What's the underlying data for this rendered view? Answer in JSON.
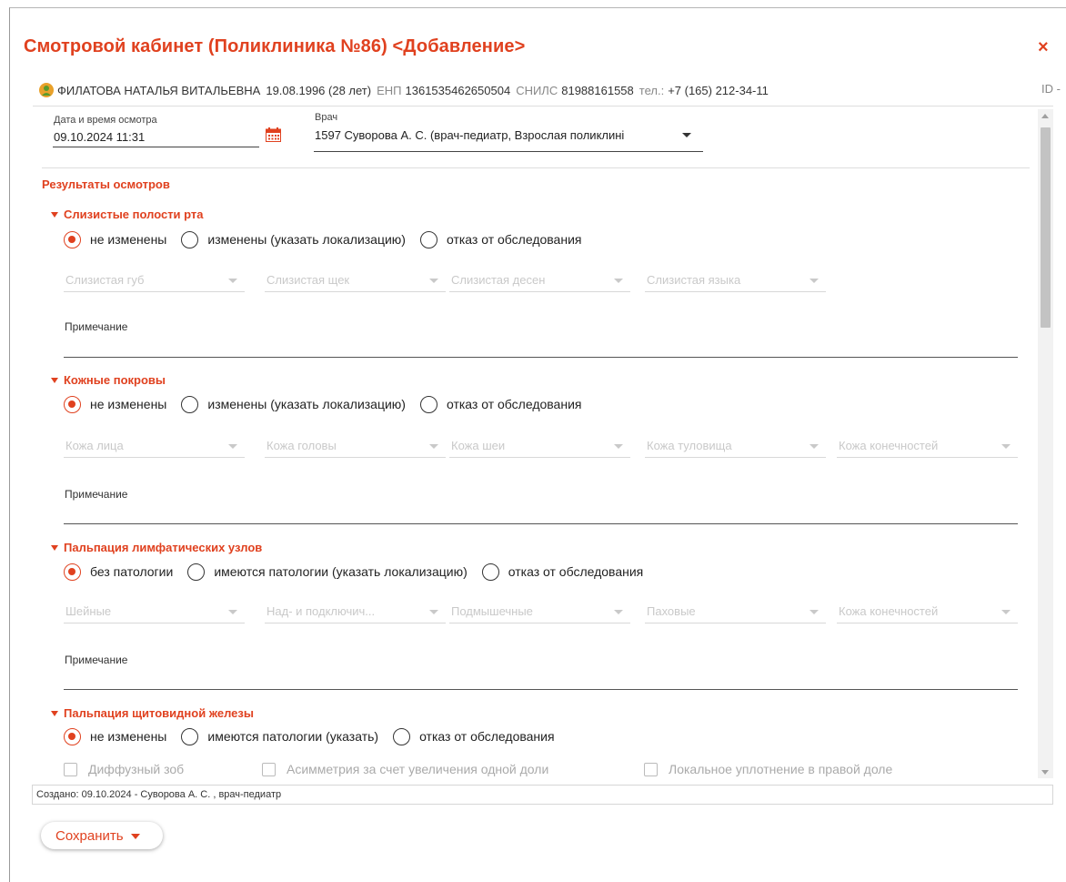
{
  "dialog": {
    "title": "Смотровой кабинет (Поликлиника №86) <Добавление>",
    "close_label": "×",
    "id_label": "ID -"
  },
  "patient": {
    "name": "ФИЛАТОВА НАТАЛЬЯ ВИТАЛЬЕВНА",
    "birth": "19.08.1996 (28 лет)",
    "enp_label": "ЕНП",
    "enp_value": "1361535462650504",
    "snils_label": "СНИЛС",
    "snils_value": "81988161558",
    "phone_label": "тел.:",
    "phone_value": "+7 (165) 212-34-11"
  },
  "exam": {
    "datetime_label": "Дата и время осмотра",
    "datetime_value": "09.10.2024 11:31",
    "doctor_label": "Врач",
    "doctor_value": "1597 Суворова А. С.  (врач-педиатр, Взрослая поликлині"
  },
  "results_title": "Результаты осмотров",
  "sections": {
    "mucosa": {
      "title": "Слизистые полости рта",
      "radios": [
        "не изменены",
        "изменены (указать локализацию)",
        "отказ от обследования"
      ],
      "selected": 0,
      "dropdowns": [
        "Слизистая губ",
        "Слизистая щек",
        "Слизистая десен",
        "Слизистая языка"
      ],
      "note_label": "Примечание"
    },
    "skin": {
      "title": "Кожные покровы",
      "radios": [
        "не изменены",
        "изменены (указать локализацию)",
        "отказ от обследования"
      ],
      "selected": 0,
      "dropdowns": [
        "Кожа лица",
        "Кожа головы",
        "Кожа шеи",
        "Кожа туловища",
        "Кожа конечностей"
      ],
      "note_label": "Примечание"
    },
    "lymph": {
      "title": "Пальпация лимфатических узлов",
      "radios": [
        "без патологии",
        "имеются патологии (указать локализацию)",
        "отказ от обследования"
      ],
      "selected": 0,
      "dropdowns": [
        "Шейные",
        "Над- и подключич...",
        "Подмышечные",
        "Паховые",
        "Кожа конечностей"
      ],
      "note_label": "Примечание"
    },
    "thyroid": {
      "title": "Пальпация щитовидной железы",
      "radios": [
        "не изменены",
        "имеются патологии (указать)",
        "отказ от обследования"
      ],
      "selected": 0,
      "checkboxes": [
        "Диффузный зоб",
        "Асимметрия за счет увеличения одной доли",
        "Локальное уплотнение в правой доле"
      ]
    }
  },
  "footer": {
    "created": "Создано: 09.10.2024 - Суворова А. С. , врач-педиатр",
    "save_label": "Сохранить"
  },
  "colors": {
    "accent": "#e0411f",
    "placeholder": "#c9c9c9"
  }
}
